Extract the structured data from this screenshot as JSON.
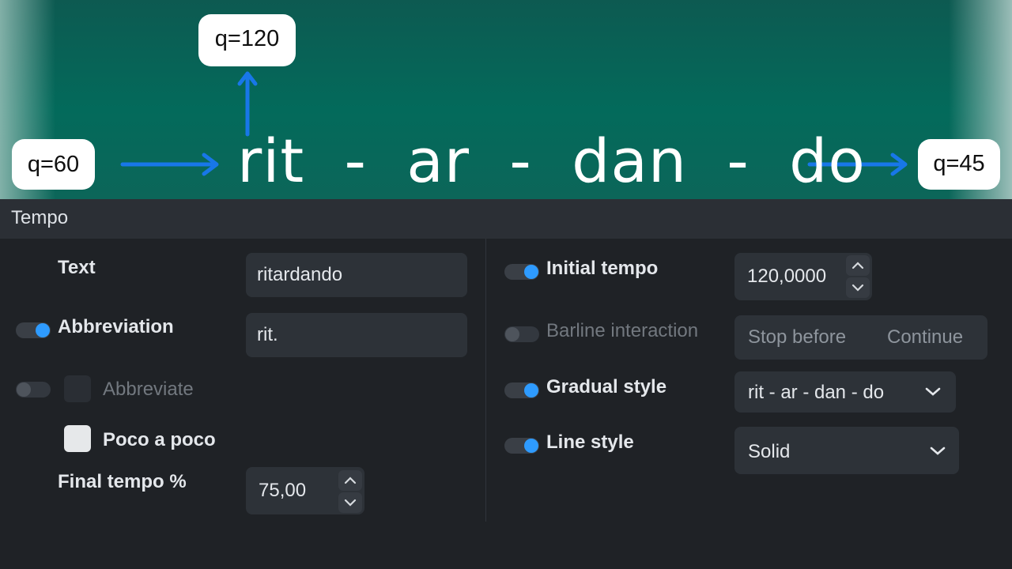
{
  "illustration": {
    "tempo_start": "q=60",
    "tempo_peak": "q=120",
    "tempo_end": "q=45",
    "phrase": "rit  -  ar  -  dan  -  do",
    "arrow_color": "#1877e8"
  },
  "panel": {
    "title": "Tempo",
    "left": {
      "text_label": "Text",
      "text_value": "ritardando",
      "abbreviation_label": "Abbreviation",
      "abbreviation_value": "rit.",
      "abbreviate_label": "Abbreviate",
      "poco_a_poco_label": "Poco a poco",
      "final_tempo_label": "Final tempo %",
      "final_tempo_value": "75,00"
    },
    "right": {
      "initial_tempo_label": "Initial tempo",
      "initial_tempo_value": "120,0000",
      "barline_label": "Barline interaction",
      "barline_options": [
        "Stop before",
        "Continue"
      ],
      "gradual_style_label": "Gradual style",
      "gradual_style_value": "rit - ar - dan - do",
      "line_style_label": "Line style",
      "line_style_value": "Solid"
    }
  },
  "colors": {
    "accent": "#2e9bff",
    "panel_bg": "#1f2226",
    "field_bg": "#2d3238"
  }
}
